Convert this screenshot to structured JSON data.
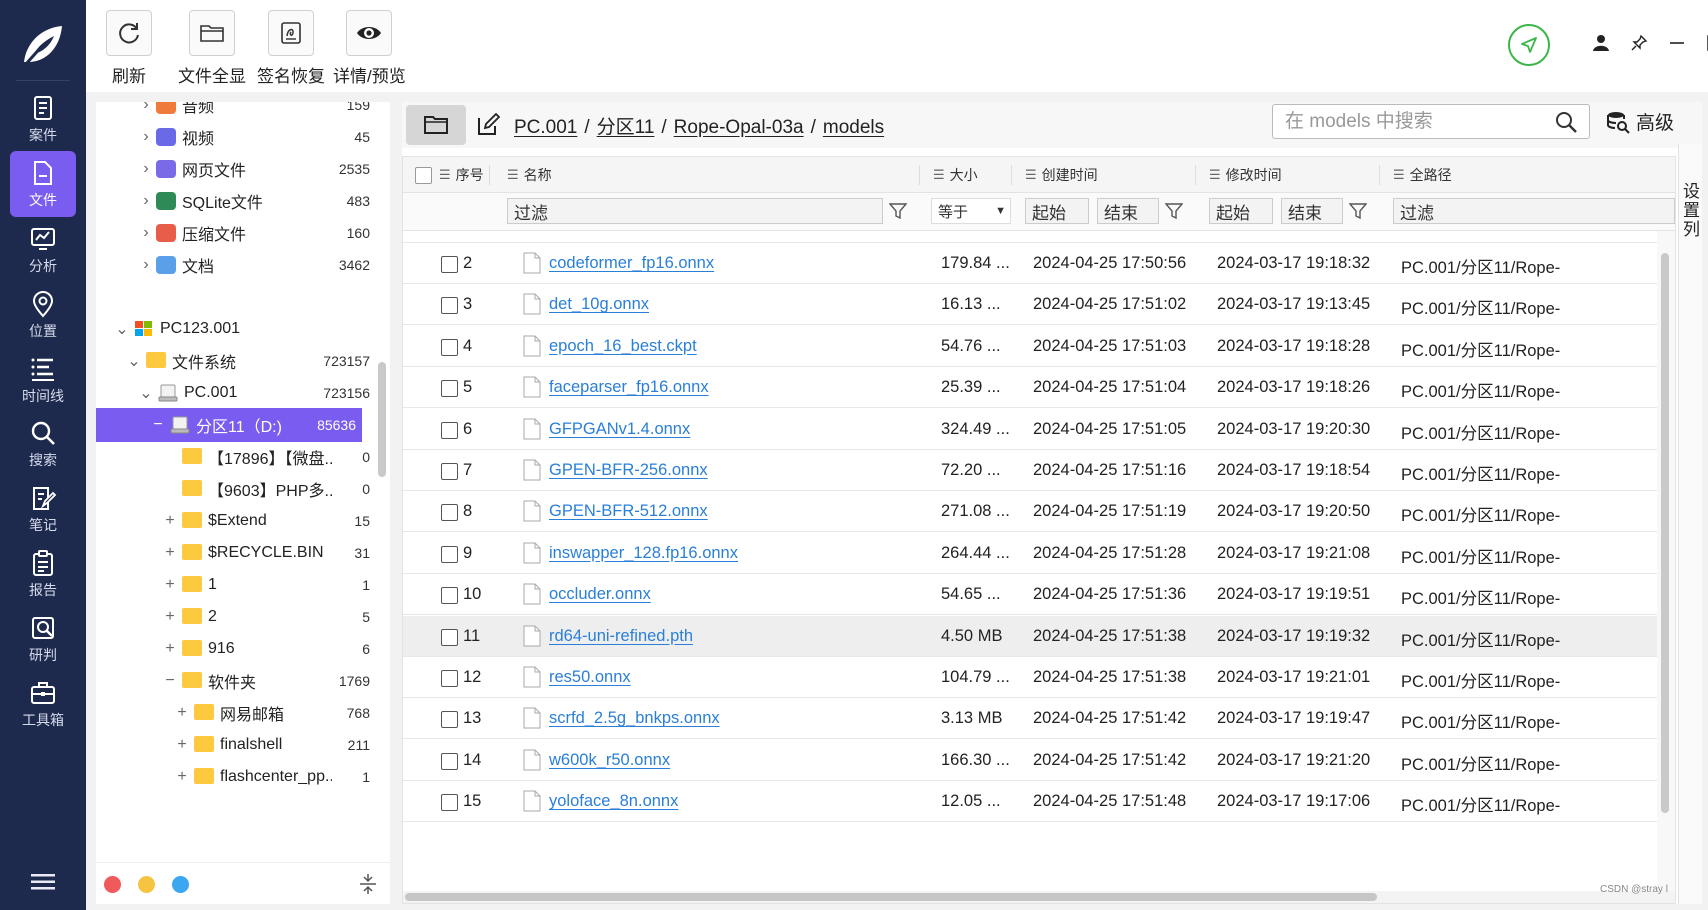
{
  "toolbar": {
    "buttons": [
      {
        "label": "刷新",
        "icon": "refresh-icon"
      },
      {
        "label": "文件全显",
        "icon": "folder-icon"
      },
      {
        "label": "签名恢复",
        "icon": "signature-icon"
      },
      {
        "label": "详情/预览",
        "icon": "eye-icon"
      }
    ]
  },
  "nav": {
    "items": [
      {
        "label": "案件",
        "icon": "case-icon"
      },
      {
        "label": "文件",
        "icon": "file-icon",
        "active": true
      },
      {
        "label": "分析",
        "icon": "analysis-icon"
      },
      {
        "label": "位置",
        "icon": "location-icon"
      },
      {
        "label": "时间线",
        "icon": "timeline-icon"
      },
      {
        "label": "搜索",
        "icon": "search-icon"
      },
      {
        "label": "笔记",
        "icon": "note-icon"
      },
      {
        "label": "报告",
        "icon": "report-icon"
      },
      {
        "label": "研判",
        "icon": "judge-icon"
      },
      {
        "label": "工具箱",
        "icon": "toolbox-icon"
      }
    ]
  },
  "tree": [
    {
      "label": "音频",
      "count": "159",
      "icon": "audio-icon",
      "exp": "›"
    },
    {
      "label": "视频",
      "count": "45",
      "icon": "video-icon",
      "exp": "›"
    },
    {
      "label": "网页文件",
      "count": "2535",
      "icon": "webpage-icon",
      "exp": "›"
    },
    {
      "label": "SQLite文件",
      "count": "483",
      "icon": "database-icon",
      "exp": "›"
    },
    {
      "label": "压缩文件",
      "count": "160",
      "icon": "archive-icon",
      "exp": "›"
    },
    {
      "label": "文档",
      "count": "3462",
      "icon": "document-icon",
      "exp": "›"
    },
    {
      "label": "PC123.001",
      "count": "",
      "icon": "windows-icon",
      "exp": "⌄"
    },
    {
      "label": "文件系统",
      "count": "723157",
      "icon": "folder-icon",
      "exp": "⌄"
    },
    {
      "label": "PC.001",
      "count": "723156",
      "icon": "drive-icon",
      "exp": "⌄"
    },
    {
      "label": "分区11（D:)",
      "count": "85636",
      "icon": "partition-icon",
      "exp": "−",
      "selected": true
    },
    {
      "label": "【17896】【微盘...",
      "count": "0",
      "icon": "folder-icon",
      "exp": ""
    },
    {
      "label": "【9603】PHP多...",
      "count": "0",
      "icon": "folder-icon",
      "exp": ""
    },
    {
      "label": "$Extend",
      "count": "15",
      "icon": "folder-icon",
      "exp": "+"
    },
    {
      "label": "$RECYCLE.BIN",
      "count": "31",
      "icon": "folder-icon",
      "exp": "+"
    },
    {
      "label": "1",
      "count": "1",
      "icon": "folder-icon",
      "exp": "+"
    },
    {
      "label": "2",
      "count": "5",
      "icon": "folder-icon",
      "exp": "+"
    },
    {
      "label": "916",
      "count": "6",
      "icon": "folder-icon",
      "exp": "+"
    },
    {
      "label": "软件夹",
      "count": "1769",
      "icon": "folder-icon",
      "exp": "−"
    },
    {
      "label": "网易邮箱",
      "count": "768",
      "icon": "folder-icon",
      "exp": "+"
    },
    {
      "label": "finalshell",
      "count": "211",
      "icon": "folder-icon",
      "exp": "+"
    },
    {
      "label": "flashcenter_pp...",
      "count": "1",
      "icon": "folder-icon",
      "exp": "+"
    }
  ],
  "path": {
    "crumbs": [
      "PC.001",
      "分区11",
      "Rope-Opal-03a",
      "models"
    ],
    "separator": "/"
  },
  "search": {
    "placeholder": "在 models 中搜索",
    "advanced_label": "高级"
  },
  "table": {
    "headers": {
      "index": "序号",
      "name": "名称",
      "size": "大小",
      "created": "创建时间",
      "modified": "修改时间",
      "fullpath": "全路径"
    },
    "filters": {
      "name": "过滤",
      "size_op": "等于",
      "created_start": "起始",
      "created_end": "结束",
      "modified_start": "起始",
      "modified_end": "结束",
      "path": "过滤"
    },
    "rows": [
      {
        "idx": "2",
        "name": "codeformer_fp16.onnx",
        "size": "179.84 ...",
        "created": "2024-04-25 17:50:56",
        "modified": "2024-03-17 19:18:32",
        "path": "PC.001/分区11/Rope-"
      },
      {
        "idx": "3",
        "name": "det_10g.onnx",
        "size": "16.13 ...",
        "created": "2024-04-25 17:51:02",
        "modified": "2024-03-17 19:13:45",
        "path": "PC.001/分区11/Rope-"
      },
      {
        "idx": "4",
        "name": "epoch_16_best.ckpt",
        "size": "54.76 ...",
        "created": "2024-04-25 17:51:03",
        "modified": "2024-03-17 19:18:28",
        "path": "PC.001/分区11/Rope-"
      },
      {
        "idx": "5",
        "name": "faceparser_fp16.onnx",
        "size": "25.39 ...",
        "created": "2024-04-25 17:51:04",
        "modified": "2024-03-17 19:18:26",
        "path": "PC.001/分区11/Rope-"
      },
      {
        "idx": "6",
        "name": "GFPGANv1.4.onnx",
        "size": "324.49 ...",
        "created": "2024-04-25 17:51:05",
        "modified": "2024-03-17 19:20:30",
        "path": "PC.001/分区11/Rope-"
      },
      {
        "idx": "7",
        "name": "GPEN-BFR-256.onnx",
        "size": "72.20 ...",
        "created": "2024-04-25 17:51:16",
        "modified": "2024-03-17 19:18:54",
        "path": "PC.001/分区11/Rope-"
      },
      {
        "idx": "8",
        "name": "GPEN-BFR-512.onnx",
        "size": "271.08 ...",
        "created": "2024-04-25 17:51:19",
        "modified": "2024-03-17 19:20:50",
        "path": "PC.001/分区11/Rope-"
      },
      {
        "idx": "9",
        "name": "inswapper_128.fp16.onnx",
        "size": "264.44 ...",
        "created": "2024-04-25 17:51:28",
        "modified": "2024-03-17 19:21:08",
        "path": "PC.001/分区11/Rope-"
      },
      {
        "idx": "10",
        "name": "occluder.onnx",
        "size": "54.65 ...",
        "created": "2024-04-25 17:51:36",
        "modified": "2024-03-17 19:19:51",
        "path": "PC.001/分区11/Rope-"
      },
      {
        "idx": "11",
        "name": "rd64-uni-refined.pth",
        "size": "4.50 MB",
        "created": "2024-04-25 17:51:38",
        "modified": "2024-03-17 19:19:32",
        "path": "PC.001/分区11/Rope-",
        "highlight": true
      },
      {
        "idx": "12",
        "name": "res50.onnx",
        "size": "104.79 ...",
        "created": "2024-04-25 17:51:38",
        "modified": "2024-03-17 19:21:01",
        "path": "PC.001/分区11/Rope-"
      },
      {
        "idx": "13",
        "name": "scrfd_2.5g_bnkps.onnx",
        "size": "3.13 MB",
        "created": "2024-04-25 17:51:42",
        "modified": "2024-03-17 19:19:47",
        "path": "PC.001/分区11/Rope-"
      },
      {
        "idx": "14",
        "name": "w600k_r50.onnx",
        "size": "166.30 ...",
        "created": "2024-04-25 17:51:42",
        "modified": "2024-03-17 19:21:20",
        "path": "PC.001/分区11/Rope-"
      },
      {
        "idx": "15",
        "name": "yoloface_8n.onnx",
        "size": "12.05 ...",
        "created": "2024-04-25 17:51:48",
        "modified": "2024-03-17 19:17:06",
        "path": "PC.001/分区11/Rope-"
      }
    ]
  },
  "settings_col_label": "设置列",
  "watermark": "CSDN @stray l",
  "colors": {
    "nav_bg": "#1e2a4d",
    "accent": "#7a5cf0",
    "link": "#2a7fd8",
    "send_ring": "#3cb54a",
    "dots": [
      "#f05a5a",
      "#f5c542",
      "#3aa7f0"
    ]
  }
}
